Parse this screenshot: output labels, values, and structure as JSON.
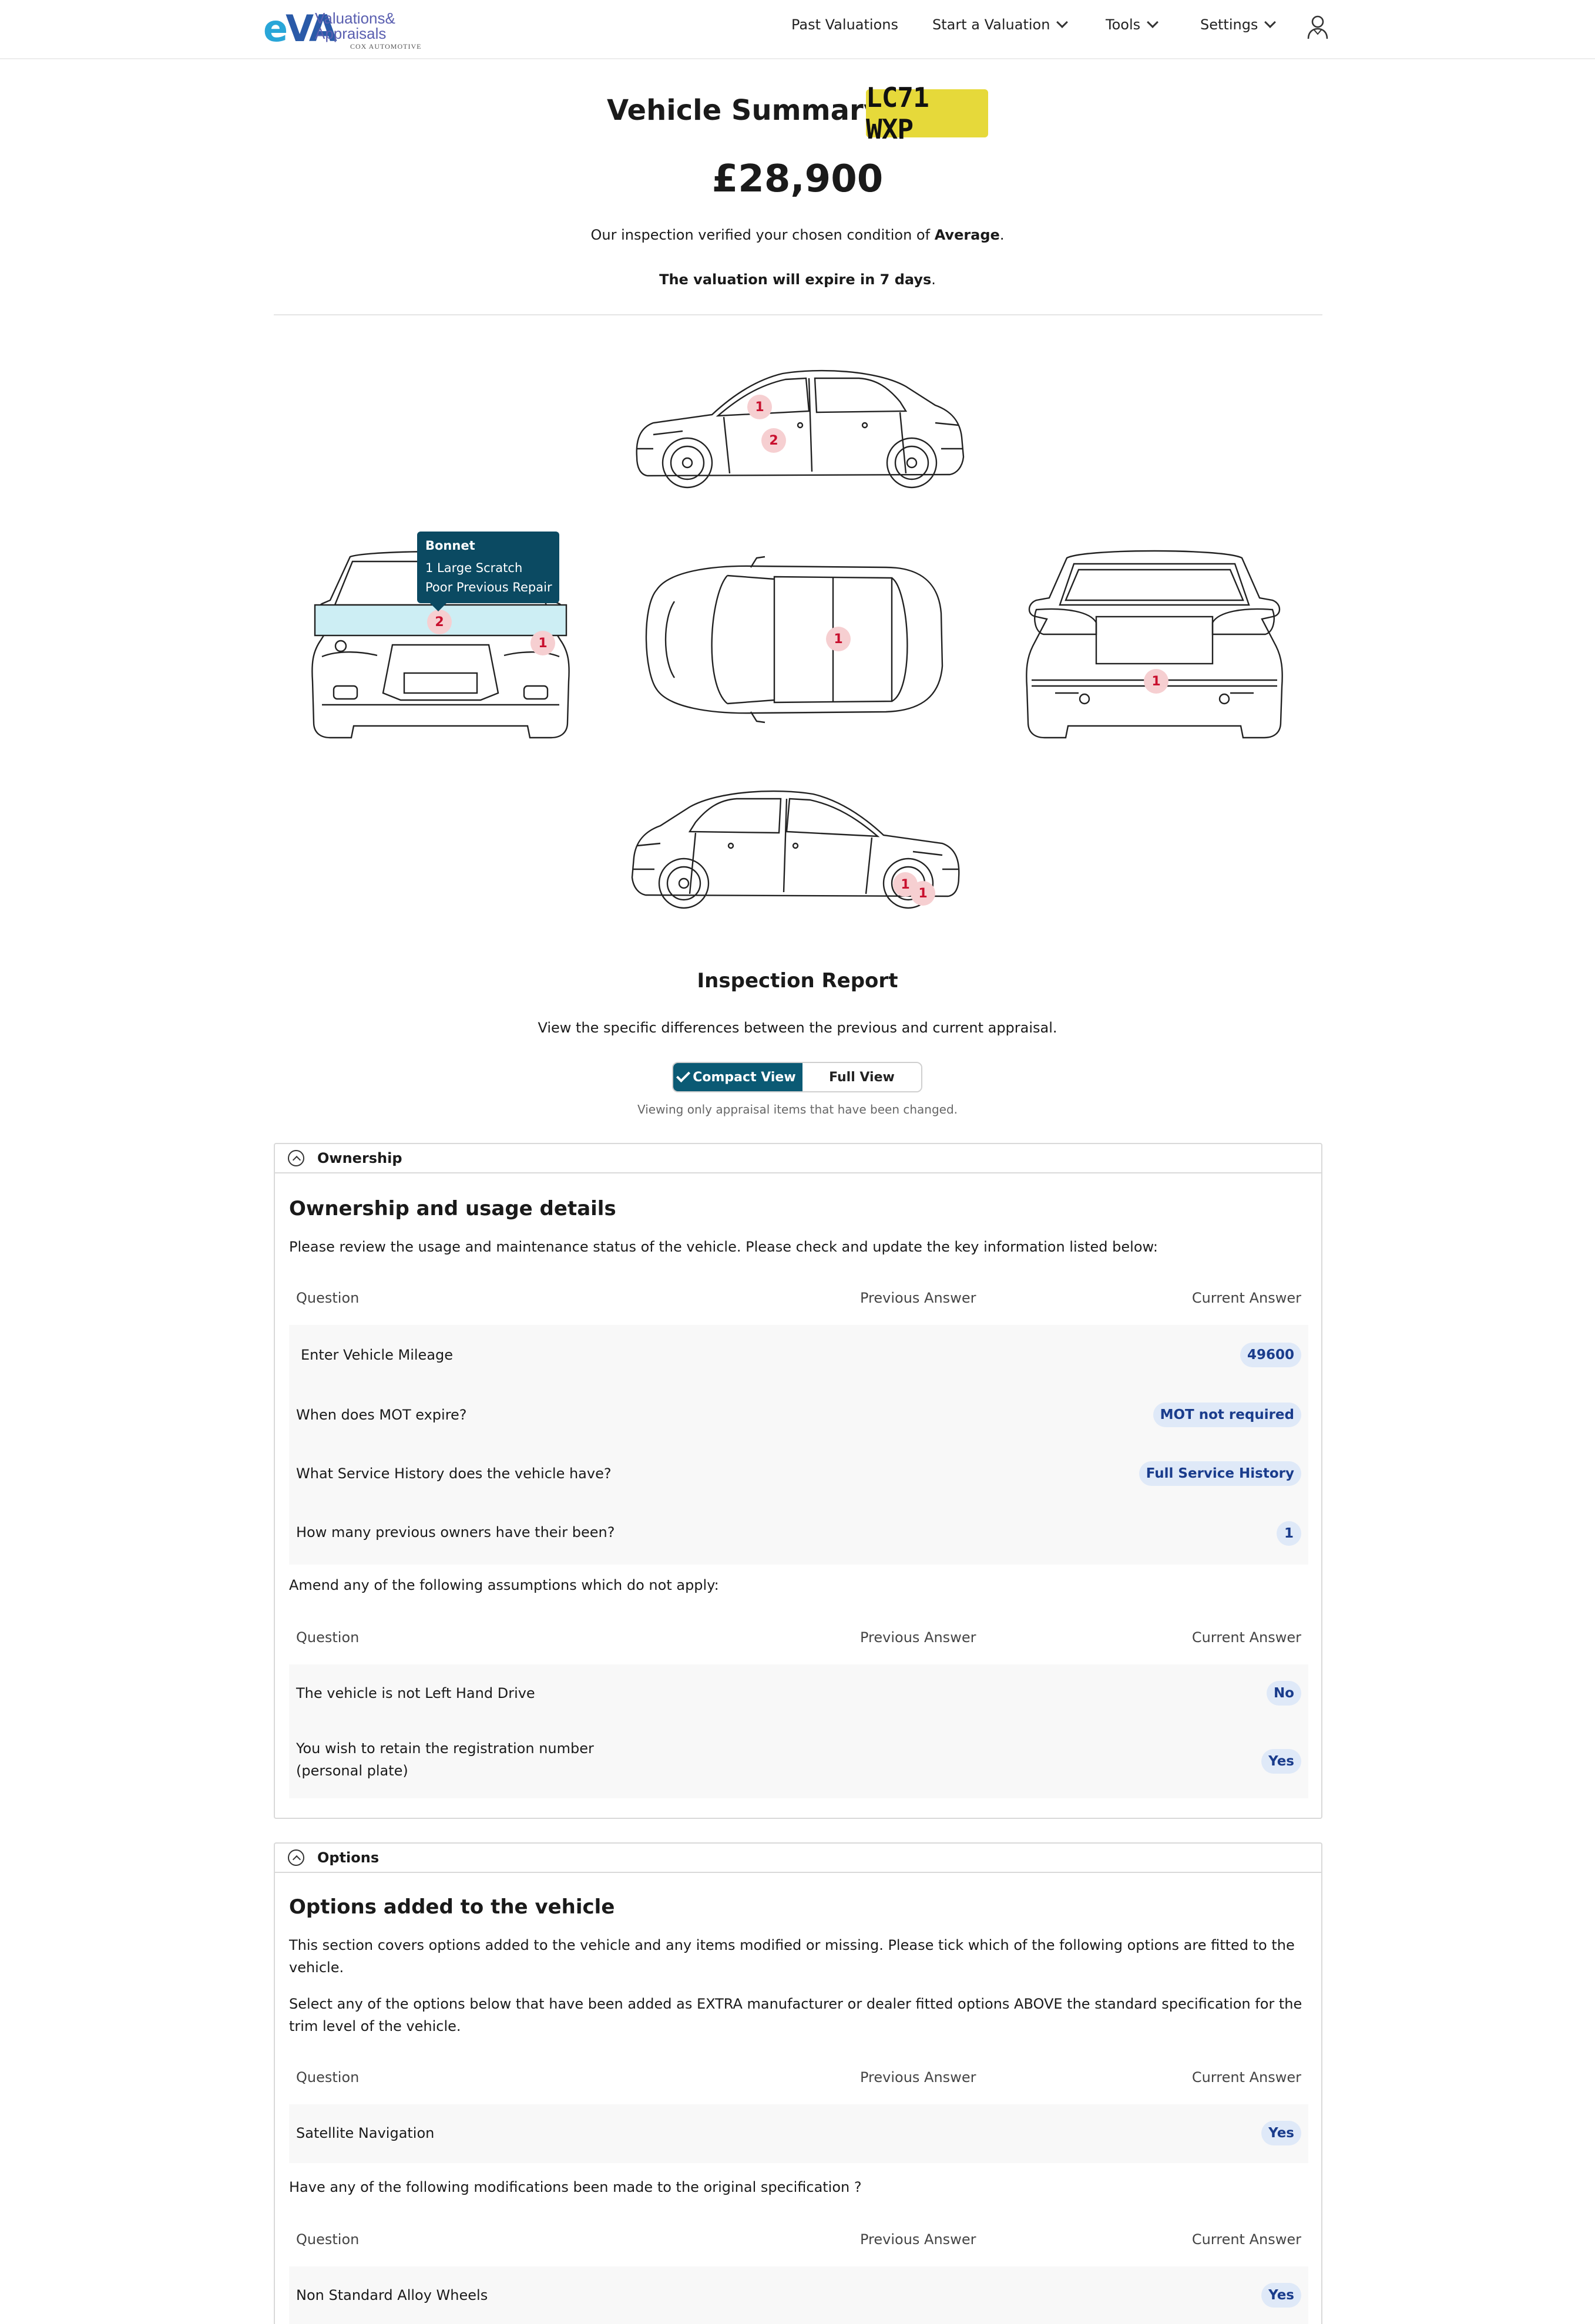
{
  "nav": {
    "logo": {
      "mark_e": "e",
      "mark_va": "VA",
      "brand": "Valuations&",
      "brand2": "Appraisals",
      "sub": "COX AUTOMOTIVE"
    },
    "items": [
      {
        "label": "Past Valuations"
      },
      {
        "label": "Start a Valuation"
      },
      {
        "label": "Tools"
      },
      {
        "label": "Settings"
      }
    ]
  },
  "summary": {
    "title": "Vehicle Summary",
    "plate": "LC71 WXP",
    "price": "£28,900",
    "verify_prefix": "Our inspection verified your chosen condition of ",
    "verify_condition": "Average",
    "verify_suffix": ".",
    "expire_bold": "The valuation will expire in 7 days",
    "expire_suffix": "."
  },
  "diagram": {
    "markers": {
      "side_top_a": "1",
      "side_top_b": "2",
      "front_a": "2",
      "front_b": "1",
      "top_a": "1",
      "rear_a": "1",
      "side_bottom_a": "1",
      "side_bottom_b": "1"
    },
    "tooltip": {
      "title": "Bonnet",
      "lines": [
        "1 Large Scratch",
        "Poor Previous Repair"
      ]
    }
  },
  "report": {
    "title": "Inspection Report",
    "description": "View the specific differences between the previous and current appraisal.",
    "toggle": {
      "active": "Compact View",
      "inactive": "Full View"
    },
    "note": "Viewing only appraisal items that have been changed."
  },
  "ownership": {
    "header": "Ownership",
    "title": "Ownership and usage details",
    "intro": "Please review the usage and maintenance status of the vehicle. Please check and update the key information listed below:",
    "columns": {
      "question": "Question",
      "previous": "Previous Answer",
      "current": "Current Answer"
    },
    "rows": [
      {
        "question": "Enter Vehicle Mileage",
        "current": "49600"
      },
      {
        "question": "When does MOT expire?",
        "current": "MOT not required"
      },
      {
        "question": "What Service History does the vehicle have?",
        "current": "Full Service History"
      },
      {
        "question": "How many previous owners have their been?",
        "current": "1"
      }
    ],
    "assumptions_label": "Amend any of the following assumptions which do not apply:",
    "assumption_rows": [
      {
        "question": "The vehicle is not Left Hand Drive",
        "current": "No"
      },
      {
        "question": "You wish to retain the registration number",
        "question_2": "(personal plate)",
        "current": "Yes"
      }
    ]
  },
  "options": {
    "header": "Options",
    "title": "Options added to the vehicle",
    "intro": "This section covers options added to the vehicle and any items modified or missing. Please tick which of the following options are fitted to the vehicle.",
    "intro2": "Select any of the options below that have been added as EXTRA manufacturer or dealer fitted options ABOVE the standard specification for the trim level of the vehicle.",
    "columns": {
      "question": "Question",
      "previous": "Previous Answer",
      "current": "Current Answer"
    },
    "rows": [
      {
        "question": "Satellite Navigation",
        "current": "Yes"
      }
    ],
    "modifications_label": "Have any of the following modifications been made to the original specification ?",
    "columns2": {
      "question": "Question",
      "previous": "Previous Answer",
      "current": "Current Answer"
    },
    "mod_rows": [
      {
        "question": "Non Standard Alloy Wheels",
        "current": "Yes"
      }
    ]
  },
  "colors": {
    "accent": "#0b5a74",
    "plate": "#e6d93a",
    "marker_bg": "#f6cfd1",
    "marker_text": "#c8102e",
    "pill_bg": "#dfe9f8",
    "pill_text": "#1a3c8c"
  }
}
